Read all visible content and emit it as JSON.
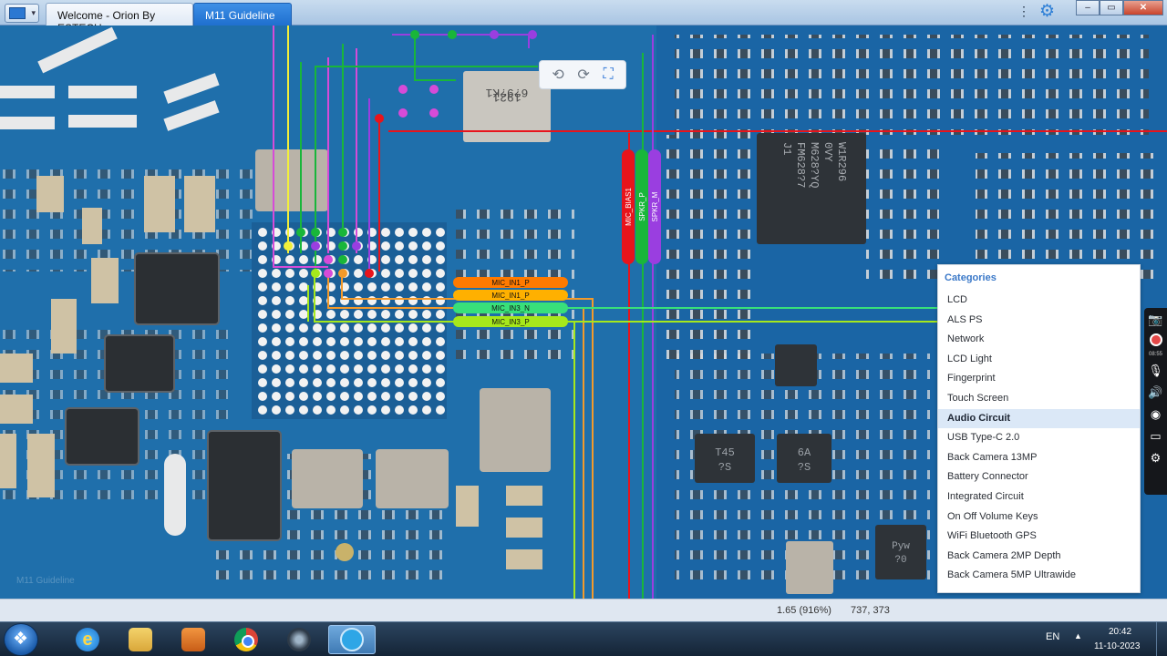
{
  "tabs": [
    {
      "label": "Welcome - Orion By ESTECH",
      "active": false
    },
    {
      "label": "M11 Guideline",
      "active": true
    }
  ],
  "window_controls": {
    "minimize": "–",
    "maximize": "▭",
    "close": "✕"
  },
  "toolbar_icons": [
    "rotate-left-icon",
    "rotate-right-icon",
    "fit-screen-icon"
  ],
  "board": {
    "signal_labels": [
      "MIC_IN1_P",
      "MIC_IN1_P",
      "MIC_IN3_N",
      "MIC_IN3_P"
    ],
    "vertical_labels": [
      "MIC_BIAS1",
      "SPKR_P",
      "SPKR_M"
    ],
    "chip_markings": {
      "upper_chip": [
        "1921",
        "6?9?K1"
      ],
      "right_chip": [
        "W1R296",
        "0VY",
        "M628?YQ",
        "FM628?7",
        "J1"
      ],
      "small_chip_a": [
        "T45",
        "?S"
      ],
      "small_chip_b": [
        "6A",
        "?S"
      ],
      "small_chip_c": [
        "Pyw",
        "?0"
      ]
    },
    "watermark": "M11 Guideline",
    "signal_colors": [
      "#ff7a00",
      "#ffb000",
      "#38e07a",
      "#a6e81c"
    ],
    "trace_colors": {
      "red": "#e8141b",
      "green": "#19b63a",
      "purple": "#9a3ee0",
      "yellow": "#f2ef3a",
      "magenta": "#d64bd8",
      "orange": "#f39a2b"
    }
  },
  "categories": {
    "title": "Categories",
    "items": [
      "LCD",
      "ALS PS",
      "Network",
      "LCD Light",
      "Fingerprint",
      "Touch Screen",
      "Audio Circuit",
      "USB Type-C 2.0",
      "Back Camera 13MP",
      "Battery Connector",
      "Integrated Circuit",
      "On Off Volume Keys",
      "WiFi Bluetooth GPS",
      "Back Camera 2MP Depth",
      "Back Camera 5MP Ultrawide"
    ],
    "selected": "Audio Circuit"
  },
  "recorder": {
    "time": "08:55"
  },
  "status": {
    "zoom": "1.65 (916%)",
    "coords": "737, 373"
  },
  "taskbar": {
    "apps": [
      "start-orb",
      "internet-explorer",
      "file-explorer",
      "media-player",
      "chrome",
      "camera",
      "orion"
    ],
    "language": "EN",
    "time": "20:42",
    "date": "11-10-2023"
  }
}
